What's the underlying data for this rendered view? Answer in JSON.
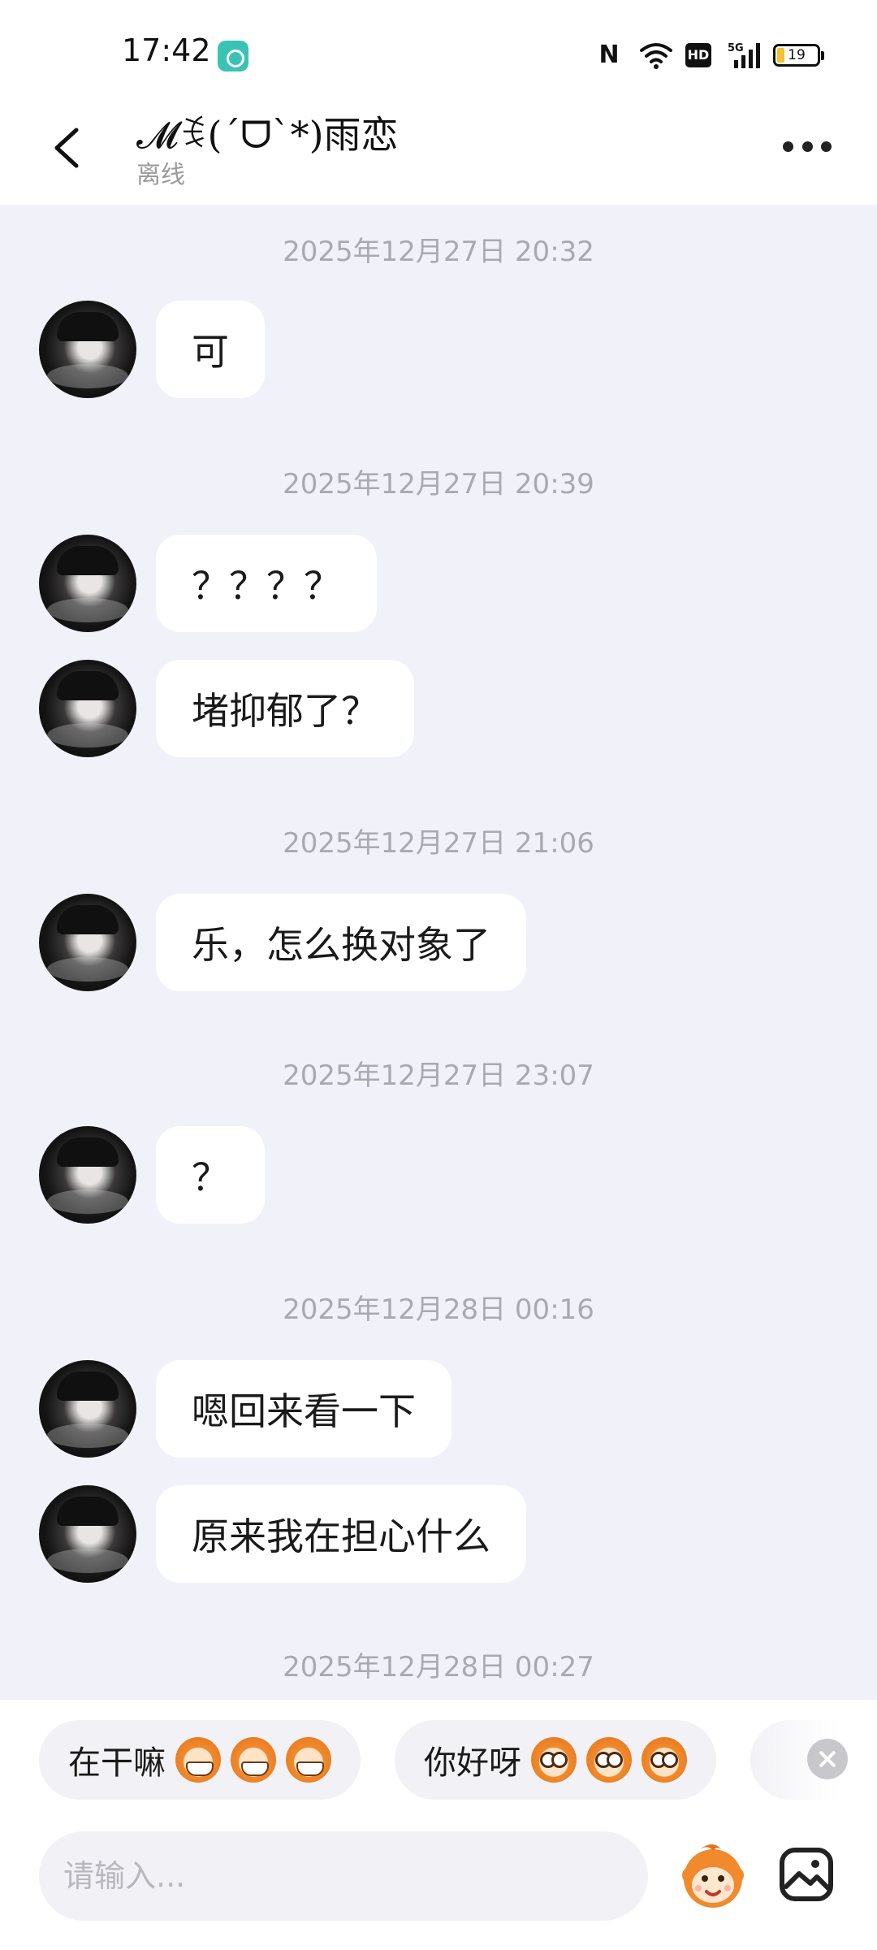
{
  "status_bar": {
    "time": "17:42",
    "battery_level": "19",
    "network": "5G",
    "hd_label": "HD",
    "nfc_label": "N"
  },
  "header": {
    "title": "𝓜ꉂ(ˊᗜˋ*)雨恋",
    "status": "离线"
  },
  "messages": [
    {
      "type": "timestamp",
      "text": "2025年12月27日 20:32"
    },
    {
      "type": "incoming",
      "text": "可"
    },
    {
      "type": "timestamp",
      "text": "2025年12月27日 20:39"
    },
    {
      "type": "incoming",
      "text": "？？？？"
    },
    {
      "type": "incoming",
      "text": "堵抑郁了？"
    },
    {
      "type": "timestamp",
      "text": "2025年12月27日 21:06"
    },
    {
      "type": "incoming",
      "text": "乐，怎么换对象了"
    },
    {
      "type": "timestamp",
      "text": "2025年12月27日 23:07"
    },
    {
      "type": "incoming",
      "text": "？"
    },
    {
      "type": "timestamp",
      "text": "2025年12月28日 00:16"
    },
    {
      "type": "incoming",
      "text": "嗯回来看一下"
    },
    {
      "type": "incoming",
      "text": "原来我在担心什么"
    },
    {
      "type": "timestamp",
      "text": "2025年12月28日 00:27"
    }
  ],
  "quick_replies": [
    {
      "label": "在干嘛",
      "emoji": "grinning-monkey-icon"
    },
    {
      "label": "你好呀",
      "emoji": "surprised-monkey-icon"
    }
  ],
  "input": {
    "placeholder": "请输入..."
  },
  "icons": {
    "back": "chevron-left-icon",
    "more": "more-dots-icon",
    "sticker": "monkey-sticker-icon",
    "image": "image-icon",
    "close": "close-icon"
  },
  "colors": {
    "chat_background": "#f1f2f9",
    "bubble": "#ffffff",
    "timestamp": "#a8aab3",
    "accent_orange": "#f08a2d"
  }
}
